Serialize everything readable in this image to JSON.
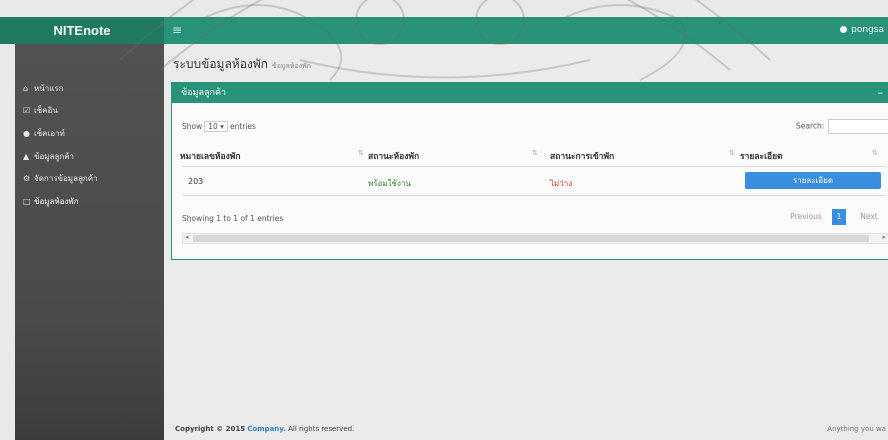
{
  "brand": "NITEnote",
  "menu_toggle": "≡",
  "user": "pongsa",
  "sidebar": {
    "items": [
      {
        "icon": "home-icon",
        "glyph": "⌂",
        "label": "หน้าแรก"
      },
      {
        "icon": "checkin-icon",
        "glyph": "☑",
        "label": "เช็คอิน"
      },
      {
        "icon": "checkout-icon",
        "glyph": "●",
        "label": "เช็คเอาท์"
      },
      {
        "icon": "user-icon",
        "glyph": "▲",
        "label": "ข้อมูลลูกค้า"
      },
      {
        "icon": "settings-icon",
        "glyph": "⚙",
        "label": "จัดการข้อมูลลูกค้า"
      },
      {
        "icon": "monitor-icon",
        "glyph": "□",
        "label": "ข้อมูลห้องพัก"
      }
    ]
  },
  "page": {
    "title": "ระบบข้อมูลห้องพัก",
    "subtitle": "ข้อมูลห้องพัก"
  },
  "panel": {
    "title": "ข้อมูลลูกค้า",
    "collapse": "–"
  },
  "table_controls": {
    "show": "Show",
    "entries_value": "10",
    "entries": "entries",
    "search_label": "Search:",
    "search_placeholder": ""
  },
  "table": {
    "columns": [
      "หมายเลขห้องพัก",
      "สถานะห้องพัก",
      "สถานะการเข้าพัก",
      "รายละเอียด"
    ],
    "rows": [
      {
        "room": "203",
        "room_status": "พร้อมใช้งาน",
        "stay_status": "ไม่ว่าง",
        "action": "รายละเอียด"
      }
    ],
    "colors": {
      "ready": "#2e8b2e",
      "busy": "#d9342b",
      "button": "#3a8ee0"
    }
  },
  "info": "Showing 1 to 1 of 1 entries",
  "pagination": {
    "previous": "Previous",
    "current": "1",
    "next": "Next"
  },
  "footer": {
    "copyright": "Copyright © 2015",
    "company": "Company.",
    "rights": "All rights reserved.",
    "right_text": "Anything you wa"
  },
  "theme": {
    "accent": "#289378",
    "brand_bg": "#1f7a61",
    "sidebar": "#4c4c4c"
  }
}
